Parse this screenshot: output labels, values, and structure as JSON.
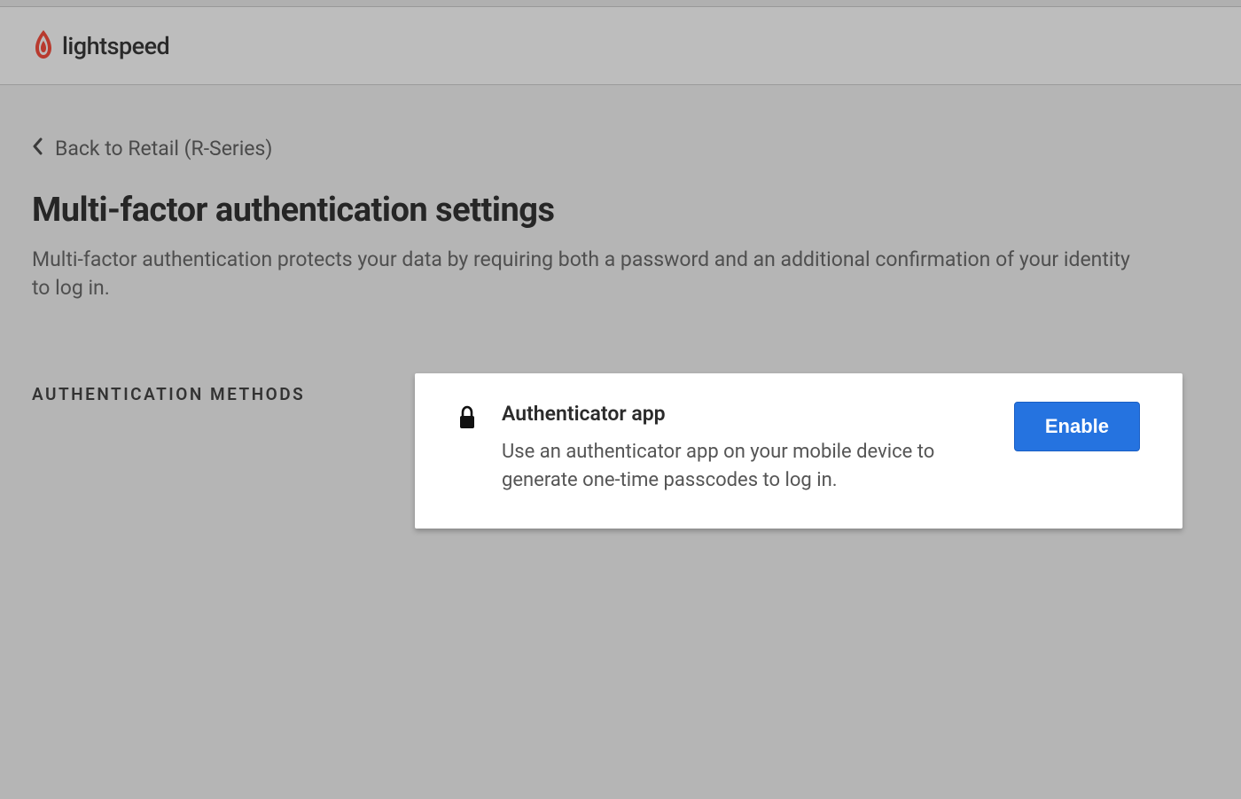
{
  "header": {
    "brand": "lightspeed"
  },
  "back": {
    "label": "Back to Retail (R-Series)"
  },
  "page": {
    "title": "Multi-factor authentication settings",
    "description": "Multi-factor authentication protects your data by requiring both a password and an additional confirmation of your identity to log in."
  },
  "section": {
    "label": "AUTHENTICATION METHODS"
  },
  "method": {
    "title": "Authenticator app",
    "description": "Use an authenticator app on your mobile device to generate one-time passcodes to log in.",
    "button": "Enable"
  }
}
